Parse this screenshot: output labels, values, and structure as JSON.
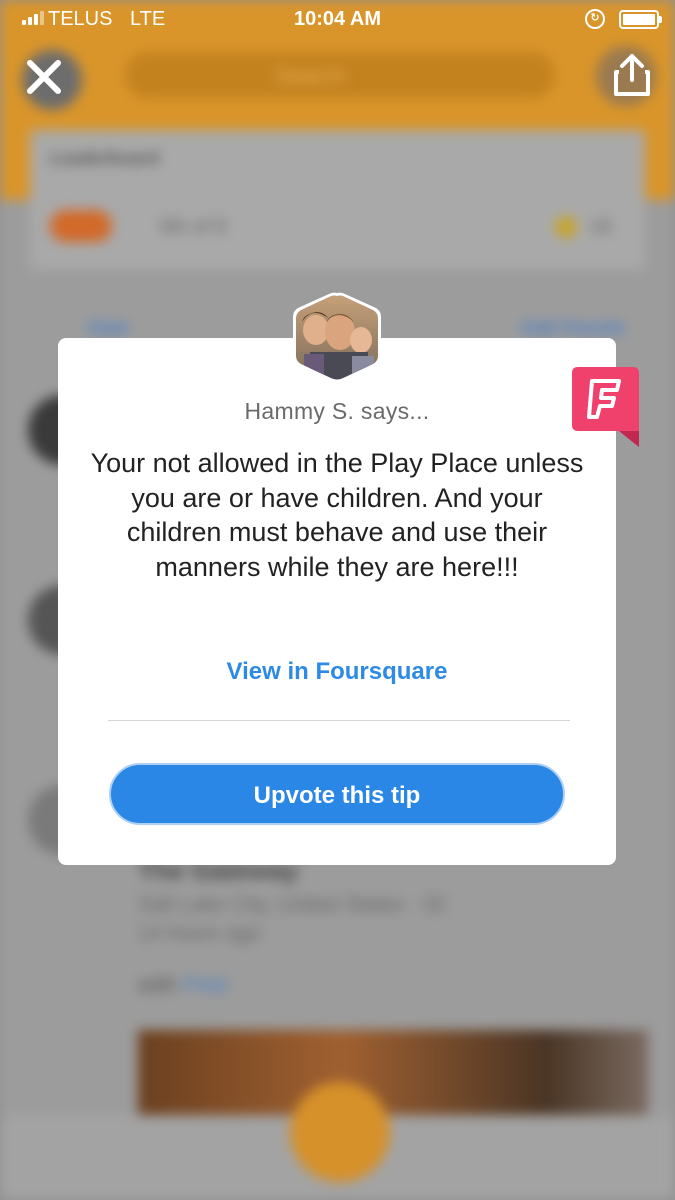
{
  "status_bar": {
    "carrier": "TELUS",
    "network": "LTE",
    "time": "10:04 AM"
  },
  "background": {
    "search_placeholder": "Search",
    "leaderboard_title": "Leaderboard",
    "leaderboard_rank": "6th of 8",
    "leaderboard_coins": "16",
    "date_filter": "Date",
    "add_friends": "Add friends",
    "venue_name": "The Gateway",
    "venue_location": "Salt Lake City, United States",
    "venue_coins": "32",
    "checkin_time": "14 hours ago",
    "with_label": "with",
    "with_name": "Pete"
  },
  "tip": {
    "author_says": "Hammy S. says...",
    "text": "Your not allowed in the Play Place unless you are or have children. And your children must behave and use their manners while they are here!!!",
    "view_link": "View in Foursquare",
    "upvote_label": "Upvote this tip"
  },
  "colors": {
    "accent_blue": "#2a87e5",
    "header_orange": "#d9952a",
    "foursquare_pink": "#f0416c"
  },
  "icons": [
    "close-icon",
    "share-icon",
    "foursquare-logo-icon",
    "avatar-photo"
  ]
}
